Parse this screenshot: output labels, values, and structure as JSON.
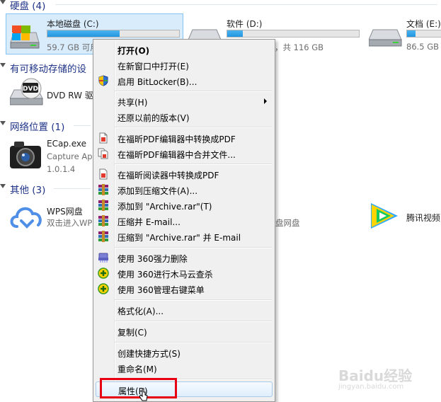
{
  "sections": {
    "hard_disks": "硬盘 (4)",
    "removable": "有可移动存储的设",
    "network": "网络位置 (1)",
    "other": "其他 (3)"
  },
  "drives": [
    {
      "name": "本地磁盘 (C:)",
      "sub": "59.7 GB 可用",
      "used": 0.55
    },
    {
      "name": "软件 (D:)",
      "sub": "，共 116 GB",
      "used": 0.12
    },
    {
      "name": "文档 (E:)",
      "sub": "86.5 GB",
      "used": 0.2
    }
  ],
  "dvd": {
    "name": "DVD RW 驱",
    "icon_text": "DVD"
  },
  "ecap": {
    "name": "ECap.exe",
    "line2": "Capture Ap",
    "line3": "1.0.1.4"
  },
  "wps": {
    "name": "WPS网盘",
    "sub": "双击进入WP",
    "sub_right": "盘网盘"
  },
  "tencent": {
    "name": "腾讯视频"
  },
  "menu": {
    "items": [
      {
        "label": "打开(O)",
        "bold": true
      },
      {
        "label": "在新窗口中打开(E)"
      },
      {
        "label": "启用 BitLocker(B)...",
        "icon": "shield-icon"
      },
      {
        "label": "共享(H)",
        "submenu": true
      },
      {
        "label": "还原以前的版本(V)"
      },
      {
        "label": "在福昕PDF编辑器中转换成PDF",
        "icon": "pdf-icon"
      },
      {
        "label": "在福昕PDF编辑器中合并文件...",
        "icon": "pdf-merge-icon"
      },
      {
        "label": "在福昕阅读器中转换成PDF",
        "icon": "pdf-icon"
      },
      {
        "label": "添加到压缩文件(A)...",
        "icon": "rar-icon"
      },
      {
        "label": "添加到 \"Archive.rar\"(T)",
        "icon": "rar-icon"
      },
      {
        "label": "压缩并 E-mail...",
        "icon": "rar-icon"
      },
      {
        "label": "压缩到 \"Archive.rar\" 并 E-mail",
        "icon": "rar-icon"
      },
      {
        "label": "使用 360强力删除",
        "icon": "shredder-icon"
      },
      {
        "label": "使用 360进行木马云查杀",
        "icon": "360-icon"
      },
      {
        "label": "使用 360管理右键菜单",
        "icon": "360-icon"
      },
      {
        "label": "格式化(A)..."
      },
      {
        "label": "复制(C)"
      },
      {
        "label": "创建快捷方式(S)"
      },
      {
        "label": "重命名(M)"
      },
      {
        "label": "属性(R)"
      }
    ]
  },
  "watermark": {
    "main": "Baidu经验",
    "sub": "jingyan.baidu.com"
  },
  "colors": {
    "accent": "#1e3287",
    "highlight": "#e60012",
    "progress": "#2396e0"
  }
}
